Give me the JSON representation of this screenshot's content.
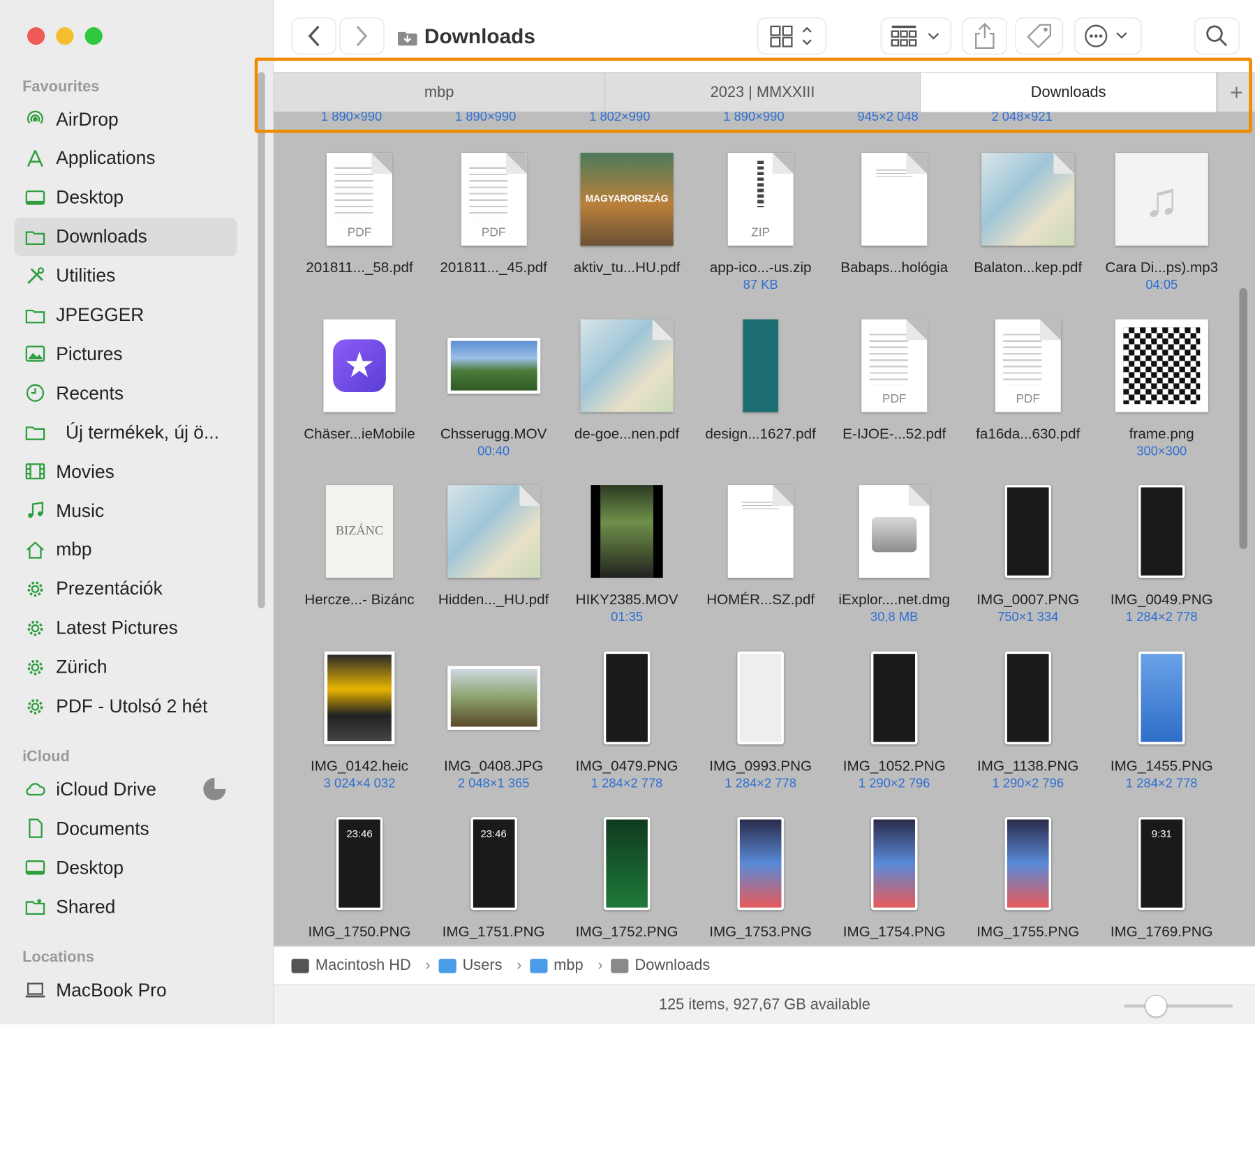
{
  "window": {
    "title": "Downloads"
  },
  "sidebar": {
    "favourites_title": "Favourites",
    "favourites": [
      {
        "label": "AirDrop",
        "icon": "airdrop-icon"
      },
      {
        "label": "Applications",
        "icon": "applications-icon"
      },
      {
        "label": "Desktop",
        "icon": "desktop-icon"
      },
      {
        "label": "Downloads",
        "icon": "downloads-folder-icon",
        "selected": true
      },
      {
        "label": "Utilities",
        "icon": "utilities-icon"
      },
      {
        "label": "JPEGGER",
        "icon": "folder-icon"
      },
      {
        "label": "Pictures",
        "icon": "pictures-icon"
      },
      {
        "label": "Recents",
        "icon": "clock-icon"
      },
      {
        "label": "Új termékek, új ö...",
        "icon": "folder-icon"
      },
      {
        "label": "Movies",
        "icon": "film-icon"
      },
      {
        "label": "Music",
        "icon": "music-note-icon"
      },
      {
        "label": "mbp",
        "icon": "home-icon"
      },
      {
        "label": "Prezentációk",
        "icon": "gear-icon"
      },
      {
        "label": "Latest Pictures",
        "icon": "gear-icon"
      },
      {
        "label": "Zürich",
        "icon": "gear-icon"
      },
      {
        "label": "PDF - Utolsó 2 hét",
        "icon": "gear-icon"
      }
    ],
    "icloud_title": "iCloud",
    "icloud": [
      {
        "label": "iCloud Drive",
        "icon": "cloud-icon"
      },
      {
        "label": "Documents",
        "icon": "document-icon"
      },
      {
        "label": "Desktop",
        "icon": "desktop-icon"
      },
      {
        "label": "Shared",
        "icon": "shared-folder-icon"
      }
    ],
    "locations_title": "Locations",
    "locations": [
      {
        "label": "MacBook Pro",
        "icon": "laptop-icon"
      }
    ]
  },
  "tabs": [
    {
      "label": "mbp",
      "active": false
    },
    {
      "label": "2023 | MMXXIII",
      "active": false
    },
    {
      "label": "Downloads",
      "active": true
    }
  ],
  "top_row_sizes": [
    "1 890×990",
    "1 890×990",
    "1 802×990",
    "1 890×990",
    "945×2 048",
    "2 048×921"
  ],
  "files": [
    {
      "name": "201811..._58.pdf",
      "sub": "",
      "kind": "pdf"
    },
    {
      "name": "201811..._45.pdf",
      "sub": "",
      "kind": "pdf"
    },
    {
      "name": "aktiv_tu...HU.pdf",
      "sub": "",
      "kind": "book",
      "cover_text": "MAGYARORSZÁG"
    },
    {
      "name": "app-ico...-us.zip",
      "sub": "87 KB",
      "kind": "zip",
      "badge": "ZIP"
    },
    {
      "name": "Babaps...hológia",
      "sub": "",
      "kind": "doc"
    },
    {
      "name": "Balaton...kep.pdf",
      "sub": "",
      "kind": "map"
    },
    {
      "name": "Cara Di...ps).mp3",
      "sub": "04:05",
      "kind": "audio"
    },
    {
      "name": "Chäser...ieMobile",
      "sub": "",
      "kind": "app"
    },
    {
      "name": "Chsserugg.MOV",
      "sub": "00:40",
      "kind": "landscape"
    },
    {
      "name": "de-goe...nen.pdf",
      "sub": "",
      "kind": "map"
    },
    {
      "name": "design...1627.pdf",
      "sub": "",
      "kind": "teal"
    },
    {
      "name": "E-IJOE-...52.pdf",
      "sub": "",
      "kind": "pdf",
      "badge": "PDF"
    },
    {
      "name": "fa16da...630.pdf",
      "sub": "",
      "kind": "pdf",
      "badge": "PDF"
    },
    {
      "name": "frame.png",
      "sub": "300×300",
      "kind": "qr"
    },
    {
      "name": "Hercze...- Bizánc",
      "sub": "",
      "kind": "bizanc",
      "cover_text": "BIZÁNC"
    },
    {
      "name": "Hidden..._HU.pdf",
      "sub": "",
      "kind": "map"
    },
    {
      "name": "HIKY2385.MOV",
      "sub": "01:35",
      "kind": "video"
    },
    {
      "name": "HOMÉR...SZ.pdf",
      "sub": "",
      "kind": "doc"
    },
    {
      "name": "iExplor....net.dmg",
      "sub": "30,8 MB",
      "kind": "dmg"
    },
    {
      "name": "IMG_0007.PNG",
      "sub": "750×1 334",
      "kind": "phone"
    },
    {
      "name": "IMG_0049.PNG",
      "sub": "1 284×2 778",
      "kind": "phone"
    },
    {
      "name": "IMG_0142.heic",
      "sub": "3 024×4 032",
      "kind": "heic"
    },
    {
      "name": "IMG_0408.JPG",
      "sub": "2 048×1 365",
      "kind": "tractor"
    },
    {
      "name": "IMG_0479.PNG",
      "sub": "1 284×2 778",
      "kind": "phone"
    },
    {
      "name": "IMG_0993.PNG",
      "sub": "1 284×2 778",
      "kind": "phone-light"
    },
    {
      "name": "IMG_1052.PNG",
      "sub": "1 290×2 796",
      "kind": "phone"
    },
    {
      "name": "IMG_1138.PNG",
      "sub": "1 290×2 796",
      "kind": "phone"
    },
    {
      "name": "IMG_1455.PNG",
      "sub": "1 284×2 778",
      "kind": "phone-blue"
    },
    {
      "name": "IMG_1750.PNG",
      "sub": "",
      "kind": "phone"
    },
    {
      "name": "IMG_1751.PNG",
      "sub": "",
      "kind": "phone"
    },
    {
      "name": "IMG_1752.PNG",
      "sub": "",
      "kind": "phone-green"
    },
    {
      "name": "IMG_1753.PNG",
      "sub": "",
      "kind": "phone-home"
    },
    {
      "name": "IMG_1754.PNG",
      "sub": "",
      "kind": "phone-home"
    },
    {
      "name": "IMG_1755.PNG",
      "sub": "",
      "kind": "phone-home"
    },
    {
      "name": "IMG_1769.PNG",
      "sub": "",
      "kind": "phone"
    }
  ],
  "phone_times": {
    "IMG_1750.PNG": "23:46",
    "IMG_1751.PNG": "23:46",
    "IMG_1769.PNG": "9:31"
  },
  "pathbar": [
    "Macintosh HD",
    "Users",
    "mbp",
    "Downloads"
  ],
  "status": {
    "text": "125 items, 927,67 GB available"
  },
  "colors": {
    "accent": "#2f6fd3",
    "highlight": "#f08a00",
    "sidebar_icon": "#2e9e3e"
  }
}
